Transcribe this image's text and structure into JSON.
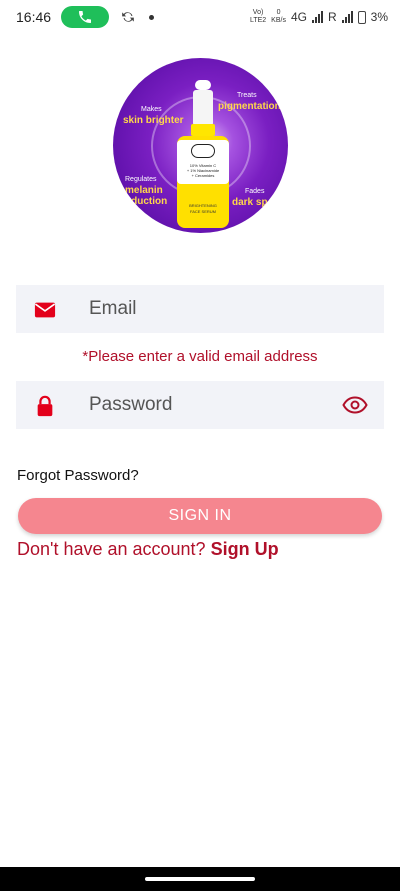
{
  "status_bar": {
    "time": "16:46",
    "volte_top": "Vo)",
    "volte_bottom": "LTE2",
    "data_speed_top": "0",
    "data_speed_bottom": "KB/s",
    "network": "4G",
    "roaming": "R",
    "battery": "3%",
    "call_color": "#1fbf5a"
  },
  "hero": {
    "makes_label": "Makes",
    "makes_value": "skin brighter",
    "treats_label": "Treats",
    "treats_value": "pigmentation",
    "regulates_label": "Regulates",
    "regulates_value": "melanin",
    "regulates_value2": "production",
    "fades_label": "Fades",
    "fades_value": "dark spots",
    "bottle_line1": "10% Vitamin C",
    "bottle_line2": "+ 1% Niacinamide",
    "bottle_line3": "+ Ceramides",
    "bottle_name1": "BRIGHTENING",
    "bottle_name2": "FACE SERUM"
  },
  "form": {
    "email_placeholder": "Email",
    "email_value": "",
    "email_error": "*Please enter a valid email address",
    "password_placeholder": "Password",
    "password_value": "",
    "forgot_label": "Forgot Password?",
    "signin_label": "SIGN IN",
    "signup_prompt": "Don't have an account?",
    "signup_link": "Sign Up"
  },
  "icons": {
    "email": "mail-icon",
    "password": "lock-icon",
    "toggle_visibility": "eye-icon"
  },
  "colors": {
    "accent": "#e3001b",
    "error": "#b0102a",
    "button": "#f5868f",
    "field_bg": "#f2f3f8"
  }
}
